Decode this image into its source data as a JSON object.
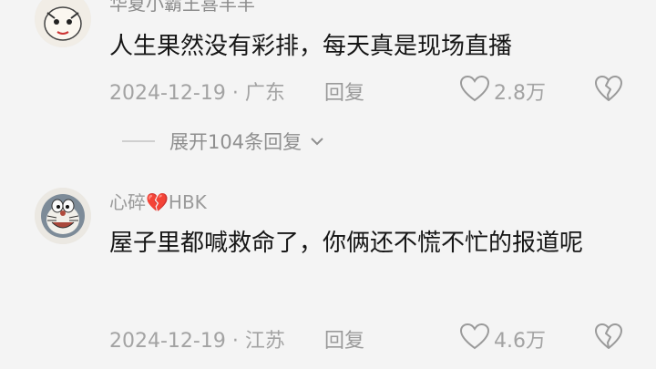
{
  "comments": [
    {
      "username": "华夏小霸王喜羊羊",
      "text": "人生果然没有彩排，每天真是现场直播",
      "date_location": "2024-12-19 · 广东",
      "reply_label": "回复",
      "like_count": "2.8万",
      "expand_replies": "展开104条回复",
      "avatar_icon": "cartoon-face-icon"
    },
    {
      "username": "心碎💔HBK",
      "text": "屋子里都喊救命了，你俩还不慌不忙的报道呢",
      "date_location": "2024-12-19 · 江苏",
      "reply_label": "回复",
      "like_count": "4.6万",
      "avatar_icon": "doraemon-icon"
    }
  ],
  "colors": {
    "background": "#f4f4f4",
    "meta_text": "#a3a3a3",
    "heart_outline": "#9a9a9a"
  }
}
